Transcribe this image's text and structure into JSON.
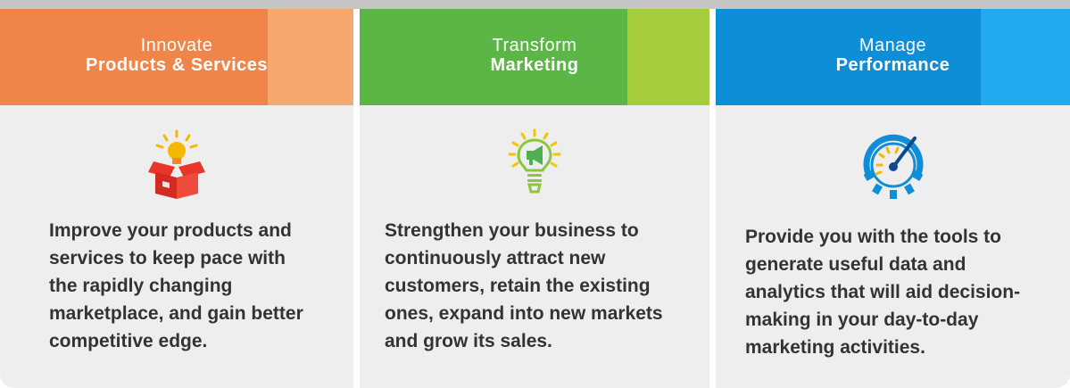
{
  "cards": [
    {
      "title_light": "Innovate",
      "title_bold": "Products & Services",
      "icon": "open-box-lightbulb-icon",
      "description": "Improve your products and services to keep pace with the rapidly changing marketplace, and gain better competitive edge."
    },
    {
      "title_light": "Transform",
      "title_bold": "Marketing",
      "icon": "megaphone-lightbulb-icon",
      "description": "Strengthen your business to continuously attract new customers, retain the existing ones, expand into new markets and grow its sales."
    },
    {
      "title_light": "Manage",
      "title_bold": "Performance",
      "icon": "gauge-gear-icon",
      "description": "Provide you with the tools to generate useful data and analytics that will aid decision-making in your day-to-day marketing activities."
    }
  ],
  "colors": {
    "orange": "#f0854a",
    "green": "#5cb646",
    "blue": "#0d8ed7",
    "card_bg": "#eeeeee"
  }
}
